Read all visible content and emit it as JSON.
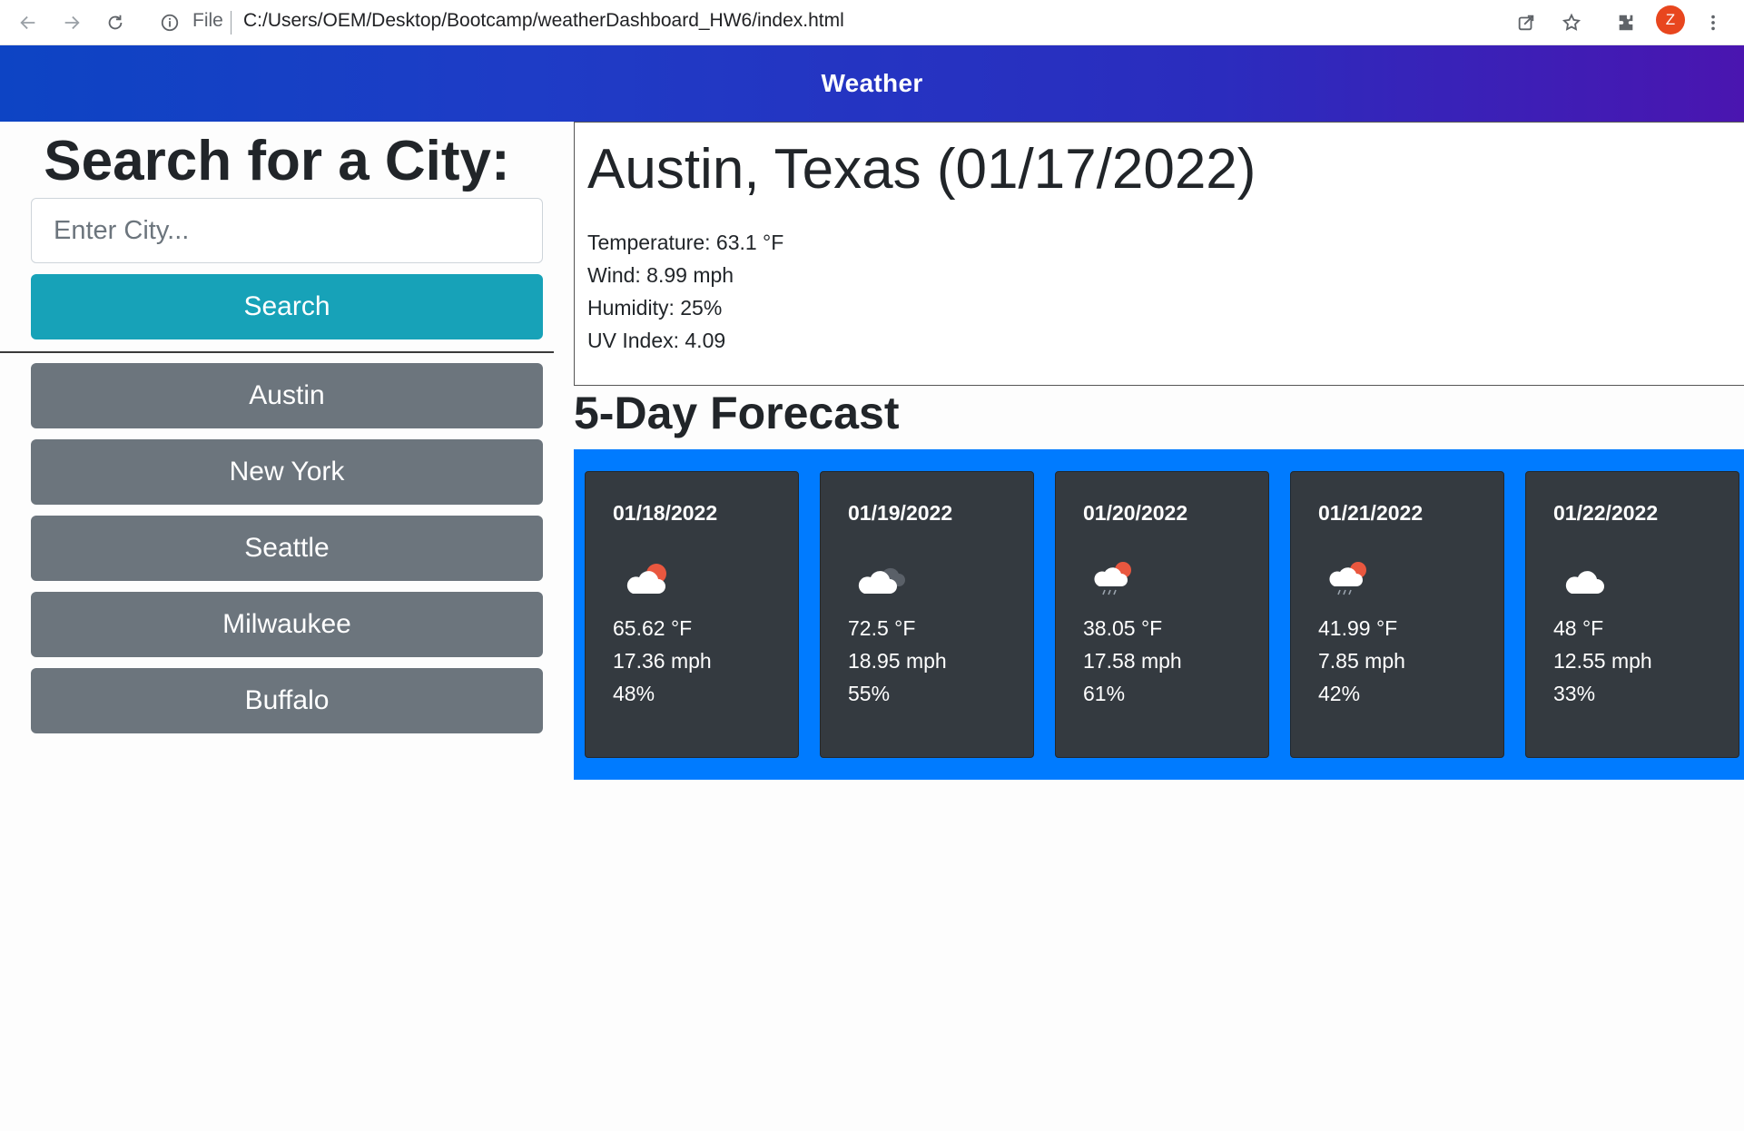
{
  "browser": {
    "scheme_label": "File",
    "url": "C:/Users/OEM/Desktop/Bootcamp/weatherDashboard_HW6/index.html",
    "profile_initial": "Z"
  },
  "header": {
    "title": "Weather"
  },
  "search": {
    "heading": "Search for a City:",
    "placeholder": "Enter City...",
    "button_label": "Search"
  },
  "history": {
    "cities": [
      "Austin",
      "New York",
      "Seattle",
      "Milwaukee",
      "Buffalo"
    ]
  },
  "current": {
    "title": "Austin, Texas (01/17/2022)",
    "temperature": "Temperature: 63.1 °F",
    "wind": "Wind: 8.99 mph",
    "humidity": "Humidity: 25%",
    "uv_index": "UV Index: 4.09"
  },
  "forecast": {
    "heading": "5-Day Forecast",
    "days": [
      {
        "date": "01/18/2022",
        "icon": "partly-cloudy-icon",
        "temp": "65.62 °F",
        "wind": "17.36 mph",
        "humidity": "48%"
      },
      {
        "date": "01/19/2022",
        "icon": "cloudy-icon",
        "temp": "72.5 °F",
        "wind": "18.95 mph",
        "humidity": "55%"
      },
      {
        "date": "01/20/2022",
        "icon": "rain-sun-icon",
        "temp": "38.05 °F",
        "wind": "17.58 mph",
        "humidity": "61%"
      },
      {
        "date": "01/21/2022",
        "icon": "rain-sun-icon",
        "temp": "41.99 °F",
        "wind": "7.85 mph",
        "humidity": "42%"
      },
      {
        "date": "01/22/2022",
        "icon": "cloud-icon",
        "temp": "48 °F",
        "wind": "12.55 mph",
        "humidity": "33%"
      }
    ]
  },
  "colors": {
    "header_gradient_start": "#0d44c4",
    "header_gradient_end": "#4a15b0",
    "search_button": "#17a2b8",
    "history_button": "#6c757d",
    "forecast_bg": "#007bff",
    "forecast_card": "#343a40"
  }
}
